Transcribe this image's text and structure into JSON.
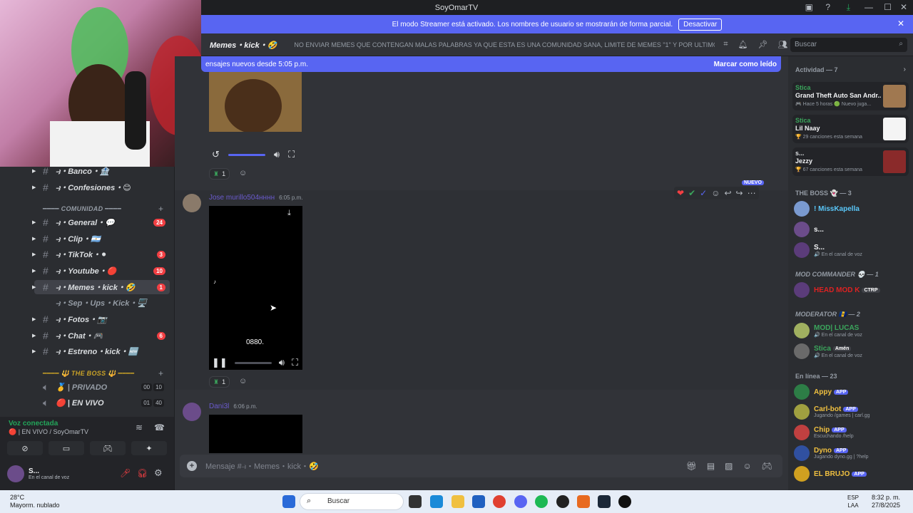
{
  "window": {
    "title": "SoyOmarTV"
  },
  "streamer_banner": {
    "text": "El modo Streamer está activado. Los nombres de usuario se mostrarán de forma parcial.",
    "button": "Desactivar"
  },
  "header": {
    "channel": "Memes・kick・🤣",
    "topic": "NO ENVIAR MEMES QUE CONTENGAN MALAS PALABRAS YA QUE ESTA ES UNA COMUNIDAD SANA, LIMITE DE MEMES \"1\" Y POR ULTIMO EL ...",
    "search_placeholder": "Buscar"
  },
  "sidebar": {
    "channels_top": [
      {
        "name": "⥽・Banco・🏦"
      },
      {
        "name": "⥽・Confesiones・😊"
      }
    ],
    "category_comunidad": "━━━━ COMUNIDAD ━━━━",
    "channels": [
      {
        "name": "⥽・General・💬",
        "badge": "24"
      },
      {
        "name": "⥽・Clip・🇦🇷",
        "badge": ""
      },
      {
        "name": "⥽・TikTok・⚫",
        "badge": "3"
      },
      {
        "name": "⥽・Youtube・🔴",
        "badge": "10"
      },
      {
        "name": "⥽・Memes・kick・🤣",
        "badge": "1"
      },
      {
        "name": "⥽・Sep・Ups・Kick・🖥️",
        "badge": ""
      },
      {
        "name": "⥽・Fotos・📷",
        "badge": ""
      },
      {
        "name": "⥽・Chat・🎮",
        "badge": "6"
      },
      {
        "name": "⥽・Estreno・kick・🆕",
        "badge": ""
      }
    ],
    "category_boss": "━━━━ 🔱 THE BOSS 🔱 ━━━━",
    "voice_channels": [
      {
        "name": "🥇 | PRIVADO",
        "c1": "00",
        "c2": "10"
      },
      {
        "name": "🔴 | EN VIVO",
        "c1": "01",
        "c2": "40"
      }
    ]
  },
  "voice": {
    "status": "Voz conectada",
    "channel": "🔴 | EN VIVO / SoyOmarTV",
    "user_name": "S...",
    "user_status": "En el canal de voz"
  },
  "chat": {
    "new_messages": "ensajes nuevos desde 5:05 p.m.",
    "mark_read": "Marcar como leído",
    "messages": [
      {
        "author": "Jose murillo504нннн",
        "time": "6:05 p.m.",
        "video_caption": "0880.",
        "reaction_count": "1",
        "new_tag": "NUEVO"
      },
      {
        "author": "Dani3l",
        "time": "6:06 p.m."
      }
    ],
    "first_reaction_count": "1",
    "input_placeholder": "Mensaje #⥽・Memes・kick・🤣"
  },
  "right": {
    "activity_header": "Actividad — 7",
    "activities": [
      {
        "user": "Stica",
        "title": "Grand Theft Auto San Andr...",
        "sub": "🎮 Hace 5 horas  🟢 Nuevo juga..."
      },
      {
        "user": "Stica",
        "title": "Lil Naay",
        "sub": "🏆 29 canciones esta semana"
      },
      {
        "user": "s...",
        "title": "Jezzy",
        "sub": "🏆 67 canciones esta semana"
      }
    ],
    "boss_header": "THE BOSS 👻 — 3",
    "boss_members": [
      {
        "name": "! MissKapella",
        "sub": ""
      },
      {
        "name": "s...",
        "sub": ""
      },
      {
        "name": "S...",
        "sub": "🔊 En el canal de voz"
      }
    ],
    "mod_cmd_header": "MOD COMMANDER 💀 — 1",
    "mod_cmd_members": [
      {
        "name": "HEAD MOD K",
        "sub": "",
        "tag": "CTRP"
      }
    ],
    "moderator_header": "MODERATOR 🇧🇧 — 2",
    "moderator_members": [
      {
        "name": "MOD| LUCAS",
        "sub": "🔊 En el canal de voz"
      },
      {
        "name": "Stica",
        "sub": "🔊 En el canal de voz",
        "tag": "Amén"
      }
    ],
    "online_header": "En línea — 23",
    "online_members": [
      {
        "name": "Appy",
        "sub": "",
        "tag": "APP"
      },
      {
        "name": "Carl-bot",
        "sub": "Jugando /games | carl.gg",
        "tag": "APP"
      },
      {
        "name": "Chip",
        "sub": "Escuchando /help",
        "tag": "APP"
      },
      {
        "name": "Dyno",
        "sub": "Jugando dyno.gg | ?help",
        "tag": "APP"
      },
      {
        "name": "EL BRUJO",
        "sub": "",
        "tag": "APP"
      }
    ]
  },
  "taskbar": {
    "temp": "28°C",
    "weather": "Mayorm. nublado",
    "search": "Buscar",
    "lang1": "ESP",
    "lang2": "LAA",
    "time": "8:32 p. m.",
    "date": "27/8/2025"
  }
}
